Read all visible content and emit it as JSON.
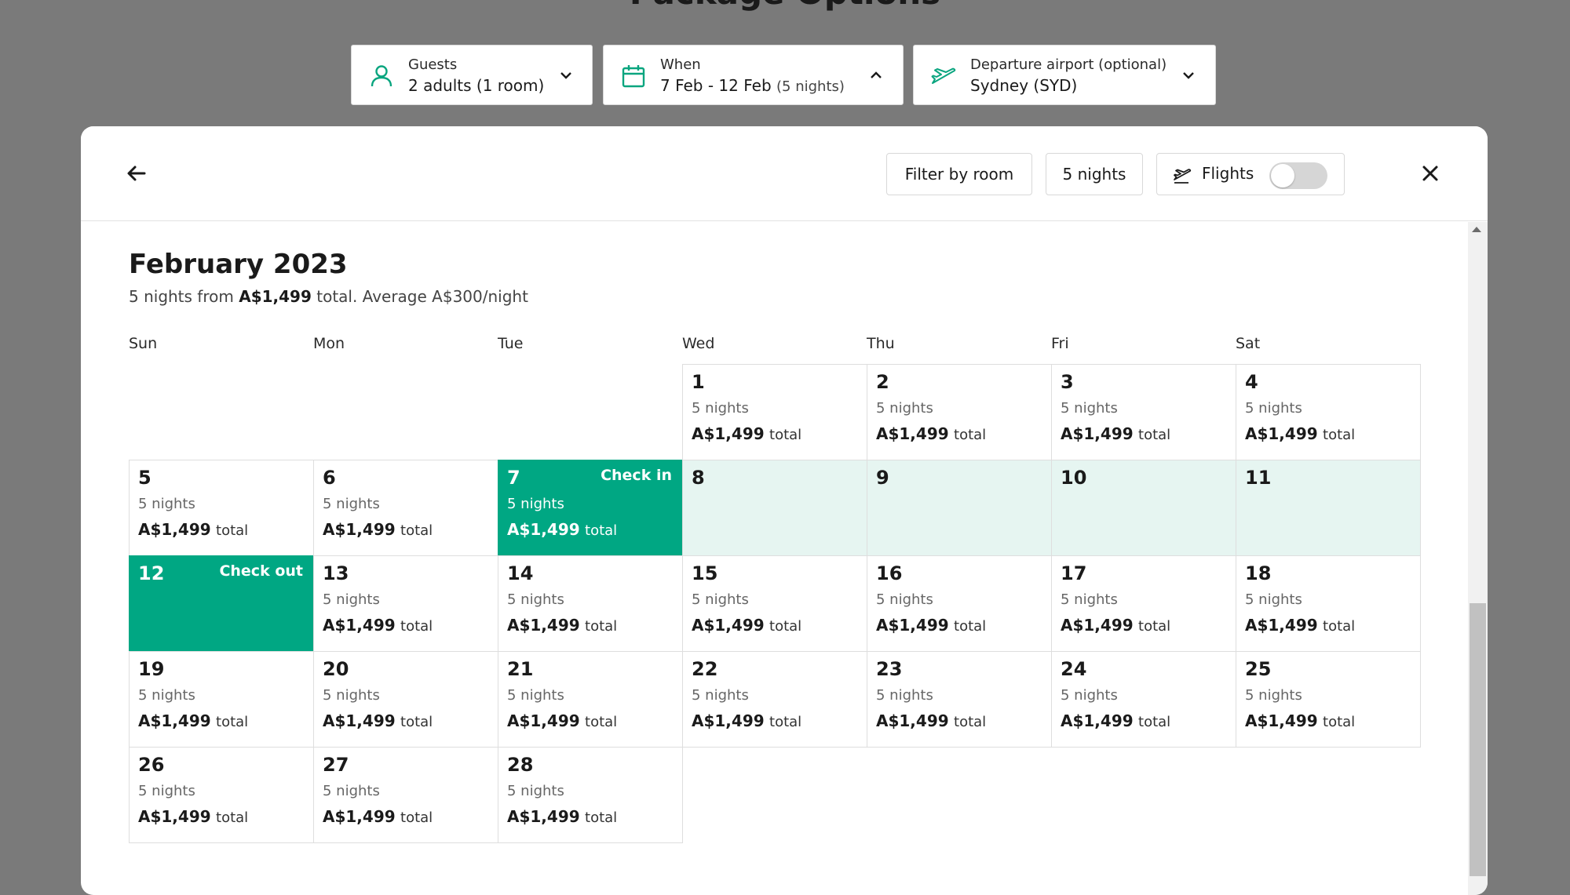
{
  "page": {
    "title": "Package Options"
  },
  "search": {
    "guests": {
      "label": "Guests",
      "value": "2 adults (1 room)"
    },
    "when": {
      "label": "When",
      "value": "7 Feb - 12 Feb",
      "nights": "(5 nights)"
    },
    "departure": {
      "label": "Departure airport (optional)",
      "value": "Sydney (SYD)"
    }
  },
  "header": {
    "filter_label": "Filter by room",
    "nights_label": "5 nights",
    "flights_label": "Flights"
  },
  "calendar": {
    "month": "February 2023",
    "summary_prefix": "5 nights from",
    "summary_price": "A$1,499",
    "summary_suffix": "total. Average A$300/night",
    "weekdays": [
      "Sun",
      "Mon",
      "Tue",
      "Wed",
      "Thu",
      "Fri",
      "Sat"
    ],
    "nights_text": "5 nights",
    "price": "A$1,499",
    "price_suffix": "total",
    "check_in_label": "Check in",
    "check_out_label": "Check out",
    "days": [
      {
        "n": "1",
        "state": "normal"
      },
      {
        "n": "2",
        "state": "normal"
      },
      {
        "n": "3",
        "state": "normal"
      },
      {
        "n": "4",
        "state": "normal"
      },
      {
        "n": "5",
        "state": "normal"
      },
      {
        "n": "6",
        "state": "normal"
      },
      {
        "n": "7",
        "state": "checkin"
      },
      {
        "n": "8",
        "state": "range"
      },
      {
        "n": "9",
        "state": "range"
      },
      {
        "n": "10",
        "state": "range"
      },
      {
        "n": "11",
        "state": "range"
      },
      {
        "n": "12",
        "state": "checkout"
      },
      {
        "n": "13",
        "state": "normal"
      },
      {
        "n": "14",
        "state": "normal"
      },
      {
        "n": "15",
        "state": "normal"
      },
      {
        "n": "16",
        "state": "normal"
      },
      {
        "n": "17",
        "state": "normal"
      },
      {
        "n": "18",
        "state": "normal"
      },
      {
        "n": "19",
        "state": "normal"
      },
      {
        "n": "20",
        "state": "normal"
      },
      {
        "n": "21",
        "state": "normal"
      },
      {
        "n": "22",
        "state": "normal"
      },
      {
        "n": "23",
        "state": "normal"
      },
      {
        "n": "24",
        "state": "normal"
      },
      {
        "n": "25",
        "state": "normal"
      },
      {
        "n": "26",
        "state": "normal"
      },
      {
        "n": "27",
        "state": "normal"
      },
      {
        "n": "28",
        "state": "normal"
      }
    ]
  },
  "icons": {
    "guests": "user-icon",
    "when": "calendar-icon",
    "departure": "plane-icon",
    "back": "arrow-left-icon",
    "close": "close-icon",
    "flights": "flights-icon"
  },
  "colors": {
    "accent": "#00a783",
    "range": "#e6f5f1",
    "icon": "#0aa57f"
  }
}
